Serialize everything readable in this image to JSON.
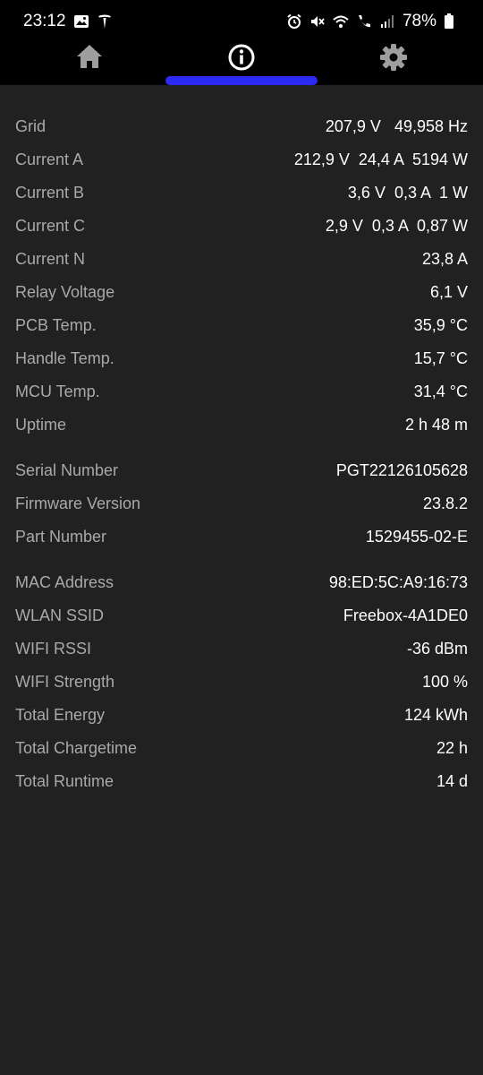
{
  "status_bar": {
    "time": "23:12",
    "battery": "78%"
  },
  "nav": {
    "tabs": [
      {
        "name": "home",
        "icon": "home-icon"
      },
      {
        "name": "info",
        "icon": "info-icon",
        "active": true
      },
      {
        "name": "settings",
        "icon": "gear-icon"
      }
    ],
    "accent_color": "#2b2bf5"
  },
  "groups": [
    {
      "rows": [
        {
          "label": "Grid",
          "value": "207,9 V   49,958 Hz"
        },
        {
          "label": "Current A",
          "value": "212,9 V  24,4 A  5194 W"
        },
        {
          "label": "Current B",
          "value": "3,6 V  0,3 A  1 W"
        },
        {
          "label": "Current C",
          "value": "2,9 V  0,3 A  0,87 W"
        },
        {
          "label": "Current N",
          "value": "23,8 A"
        },
        {
          "label": "Relay Voltage",
          "value": "6,1 V"
        },
        {
          "label": "PCB Temp.",
          "value": "35,9 °C"
        },
        {
          "label": "Handle Temp.",
          "value": "15,7 °C"
        },
        {
          "label": "MCU Temp.",
          "value": "31,4 °C"
        },
        {
          "label": "Uptime",
          "value": "2 h 48 m"
        }
      ]
    },
    {
      "rows": [
        {
          "label": "Serial Number",
          "value": "PGT22126105628"
        },
        {
          "label": "Firmware Version",
          "value": "23.8.2"
        },
        {
          "label": "Part Number",
          "value": "1529455-02-E"
        }
      ]
    },
    {
      "rows": [
        {
          "label": "MAC Address",
          "value": "98:ED:5C:A9:16:73"
        },
        {
          "label": "WLAN SSID",
          "value": "Freebox-4A1DE0"
        },
        {
          "label": "WIFI RSSI",
          "value": "-36 dBm"
        },
        {
          "label": "WIFI Strength",
          "value": "100 %"
        },
        {
          "label": "Total Energy",
          "value": "124 kWh"
        },
        {
          "label": "Total Chargetime",
          "value": "22 h"
        },
        {
          "label": "Total Runtime",
          "value": "14 d"
        }
      ]
    }
  ]
}
